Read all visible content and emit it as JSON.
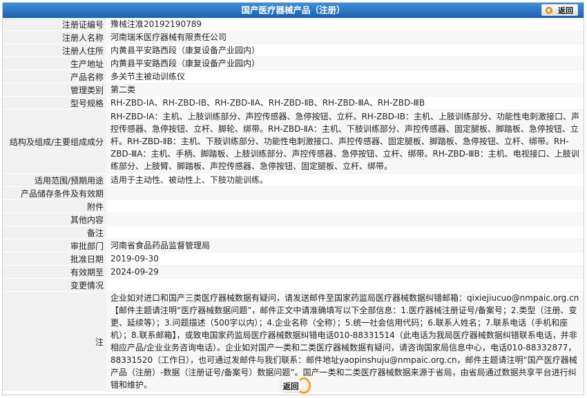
{
  "header": {
    "title": "国产医疗器械产品（注册）",
    "back_label": "返回"
  },
  "rows": [
    {
      "label": "注册证编号",
      "value": "豫械注准20192190789"
    },
    {
      "label": "注册人名称",
      "value": "河南瑞禾医疗器械有限责任公司"
    },
    {
      "label": "注册人住所",
      "value": "内黄县平安路西段（康复设备产业园内）"
    },
    {
      "label": "生产地址",
      "value": "内黄县平安路西段（康复设备产业园内）"
    },
    {
      "label": "产品名称",
      "value": "多关节主被动训练仪"
    },
    {
      "label": "管理类别",
      "value": "第二类"
    },
    {
      "label": "型号规格",
      "value": "RH-ZBD-ⅠA、RH-ZBD-ⅠB、RH-ZBD-ⅡA、RH-ZBD-ⅡB、RH-ZBD-ⅢA、RH-ZBD-ⅢB"
    },
    {
      "label": "结构及组成/主要组成成分",
      "value": "RH-ZBD-ⅠA：主机、上肢训练部分、声控传感器、急停按钮、立杆。RH-ZBD-ⅠB：主机、上肢训练部分、功能性电刺激接口、声控传感器、急停按钮、立杆、脚轮、绑带。RH-ZBD-ⅡA：主机、下肢训练部分、声控传感器、固定腿板、脚踏板、急停按钮、立杆。RH-ZBD-ⅡB：主机、下肢训练部分、功能性电刺激接口、声控传感器、固定腿板、脚踏板、急停按钮、立杆、绑带。RH-ZBD-ⅢA：主机、手柄、脚踏板、上肢训练部分、声控传感器、急停按钮、立杆、绑带。RH-ZBD-ⅢB：主机、电视接口、上肢训练部分、上肢臂、脚踏板、声控传感器、急停按钮、固定腿板、立杆、绑带。"
    },
    {
      "label": "适用范围/预期用途",
      "value": "适用于主动性、被动性上、下肢功能训练。"
    },
    {
      "label": "产品储存条件及有效期",
      "value": ""
    },
    {
      "label": "附件",
      "value": ""
    },
    {
      "label": "其他内容",
      "value": ""
    },
    {
      "label": "备注",
      "value": ""
    },
    {
      "label": "审批部门",
      "value": "河南省食品药品监督管理局"
    },
    {
      "label": "批准日期",
      "value": "2019-09-30"
    },
    {
      "label": "有效期至",
      "value": "2024-09-29"
    },
    {
      "label": "变更情况",
      "value": ""
    },
    {
      "label": "注",
      "value": "企业如对进口和国产三类医疗器械数据有疑问，请发送邮件至国家药监局医疗器械数据纠错邮箱：qixiejiucuo@nmpaic.org.cn【邮件主题请注明“医疗器械数据问题”，邮件正文中请准确填写以下全部信息：1.医疗器械注册证号/备案号；2.类型（注册、变更、延续等）；3.问题描述（500字以内）；4.企业名称（全称）；5.统一社会信用代码；6.联系人姓名；7.联系电话（手机和座机）；8.联系邮箱】，或致电国家药监局医疗器械数据纠错电话010-88331514（此电话为我局医疗器械数据纠错联系电话，并非相应产品/企业业务咨询电话）。企业如对国产一类和二类医疗器械数据有疑问，请咨询国家局信息中心，电话010-88332877，88331520（工作日），也可通过发邮件与我们联系：邮件地址yaopinshuju@nmpaic.org.cn，邮件主题请注明“国产医疗器械产品（注册）-数据（注册证号/备案号）数据问题”。国产一类和二类医疗器械数据来源于省局，由省局通过数据共享平台进行纠错和维护。"
    }
  ],
  "footer": {
    "back_label": "返回"
  }
}
